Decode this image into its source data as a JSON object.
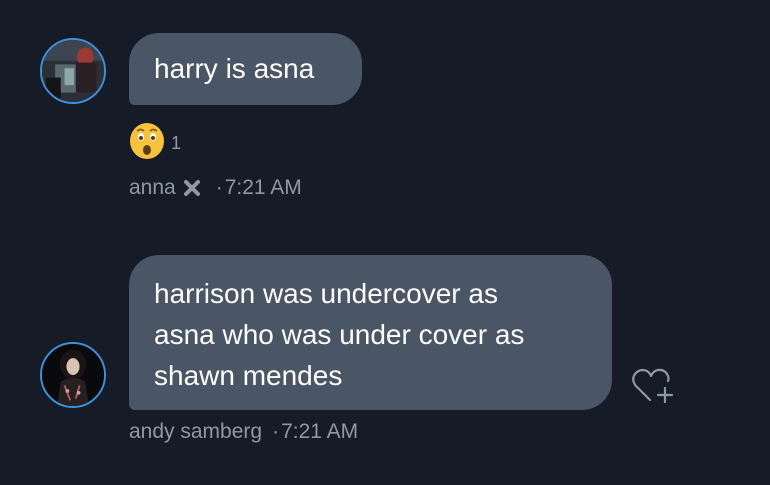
{
  "messages": [
    {
      "text_lines": [
        "harry is asna"
      ],
      "reaction": {
        "emoji": "astonished-face",
        "count": "1"
      },
      "sender": "anna",
      "sender_badge_icon": "x-icon",
      "separator": "·",
      "time": "7:21 AM"
    },
    {
      "text_lines": [
        "harrison was undercover as",
        "asna who was under cover as",
        "shawn mendes"
      ],
      "sender": "andy samberg",
      "separator": "·",
      "time": "7:21 AM",
      "action_icon": "heart-plus-icon"
    }
  ],
  "colors": {
    "background": "#151c28",
    "bubble": "#4a5565",
    "meta_text": "#8f98a6",
    "avatar_ring": "#3f8fd8"
  }
}
